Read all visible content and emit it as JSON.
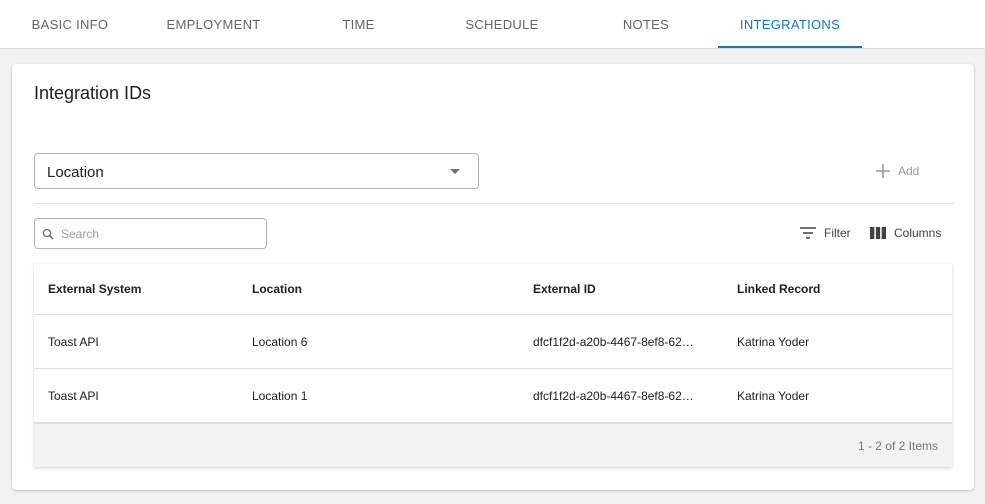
{
  "tabs": [
    {
      "label": "BASIC INFO"
    },
    {
      "label": "EMPLOYMENT"
    },
    {
      "label": "TIME"
    },
    {
      "label": "SCHEDULE"
    },
    {
      "label": "NOTES"
    },
    {
      "label": "INTEGRATIONS",
      "active": true
    }
  ],
  "card": {
    "title": "Integration IDs"
  },
  "location_select": {
    "value": "Location"
  },
  "toolbar": {
    "add_label": "Add",
    "search_placeholder": "Search",
    "filter_label": "Filter",
    "columns_label": "Columns"
  },
  "grid": {
    "columns": [
      "External System",
      "Location",
      "External ID",
      "Linked Record"
    ],
    "rows": [
      [
        "Toast API",
        "Location 6",
        "dfcf1f2d-a20b-4467-8ef8-62…",
        "Katrina Yoder"
      ],
      [
        "Toast API",
        "Location 1",
        "dfcf1f2d-a20b-4467-8ef8-62…",
        "Katrina Yoder"
      ]
    ],
    "pager": "1 - 2 of 2 Items"
  },
  "colors": {
    "accent": "#1577b8",
    "muted": "#9a9a9a"
  },
  "icons": [
    "plus-icon",
    "search-icon",
    "filter-icon",
    "columns-icon",
    "chevron-down-icon"
  ]
}
